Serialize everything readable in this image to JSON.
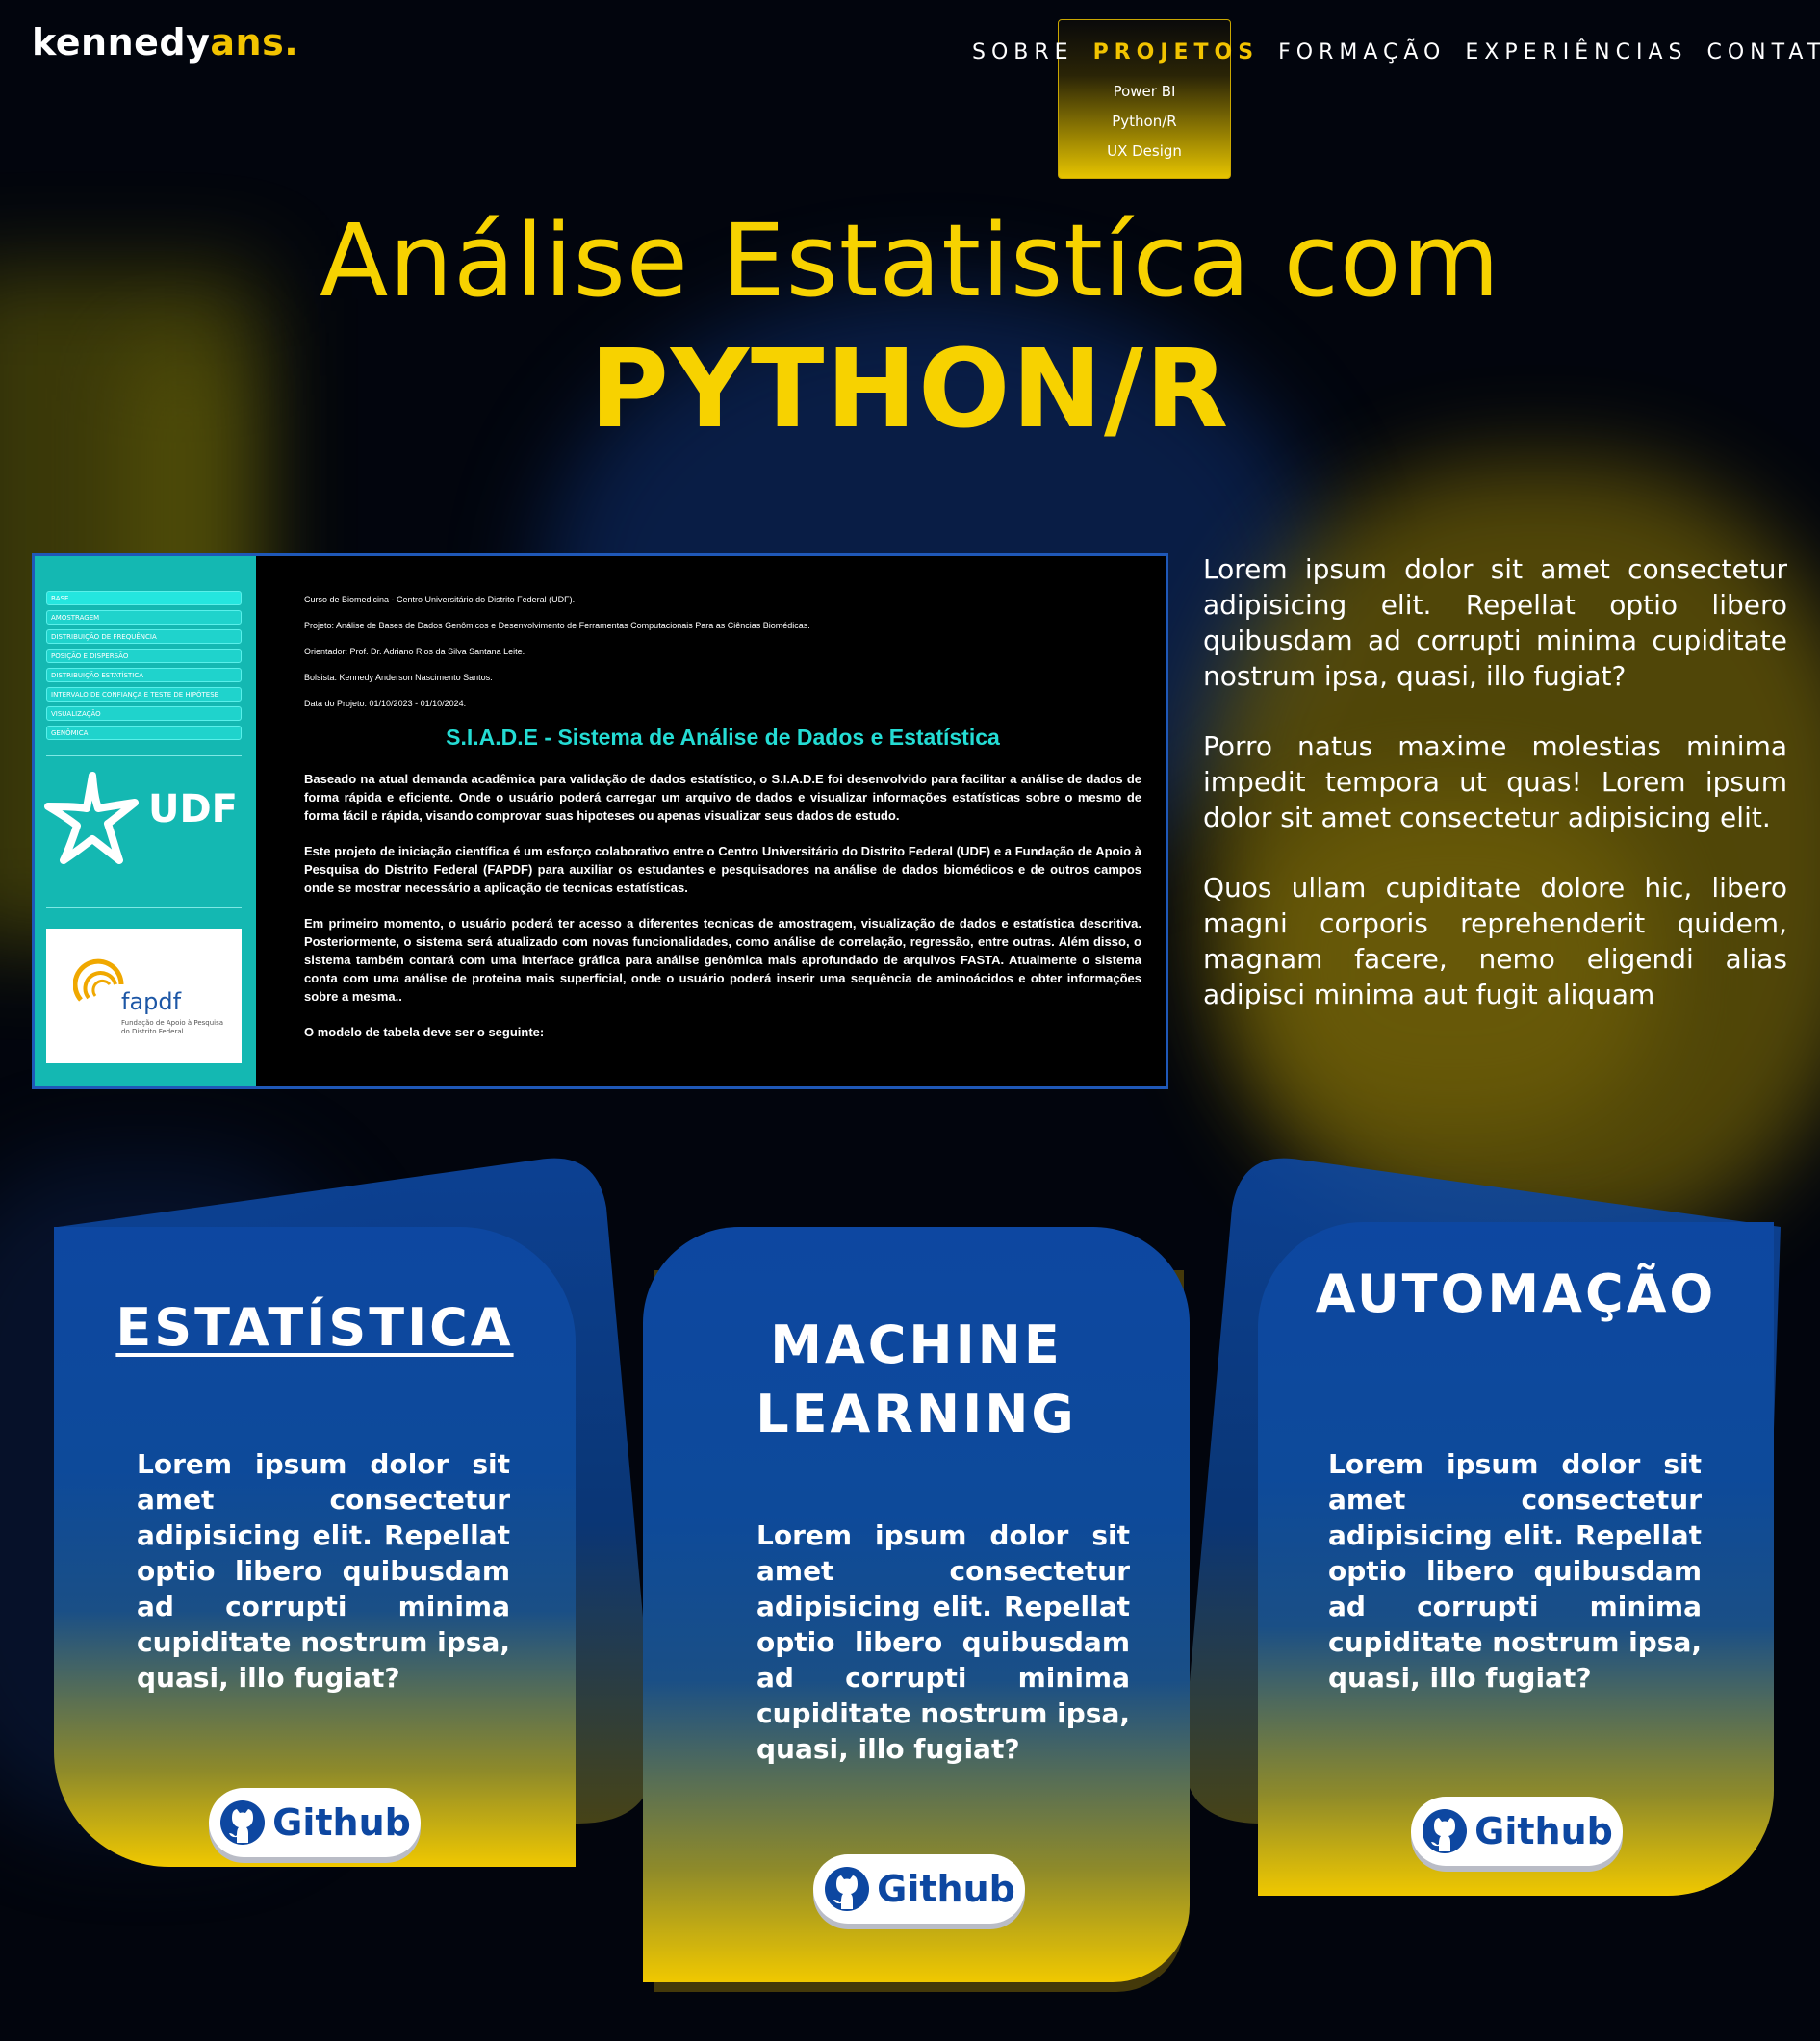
{
  "header": {
    "logo_main": "kennedy",
    "logo_accent": "ans.",
    "nav": [
      "SOBRE",
      "PROJETOS",
      "FORMAÇÃO",
      "EXPERIÊNCIAS",
      "CONTATOS"
    ],
    "dropdown": [
      "Power BI",
      "Python/R",
      "UX Design"
    ]
  },
  "hero": {
    "line1": "Análise Estatistíca com",
    "line2": "PYTHON/R"
  },
  "screenshot": {
    "menu": [
      "BASE",
      "AMOSTRAGEM",
      "DISTRIBUIÇÃO DE FREQUÊNCIA",
      "POSIÇÃO E DISPERSÃO",
      "DISTRIBUIÇÃO ESTATÍSTICA",
      "INTERVALO DE CONFIANÇA E TESTE DE HIPÓTESE",
      "VISUALIZAÇÃO",
      "GENÔMICA"
    ],
    "udf_logo": "UDF",
    "fapdf_logo": "fapdf",
    "fapdf_sub": "Fundação de Apoio à Pesquisa do Distrito Federal",
    "meta": [
      "Curso de Biomedicina - Centro Universitário do Distrito Federal (UDF).",
      "Projeto: Análise de Bases de Dados Genômicos e Desenvolvimento de Ferramentas Computacionais Para as Ciências Biomédicas.",
      "Orientador: Prof. Dr. Adriano Rios da Silva Santana Leite.",
      "Bolsista: Kennedy Anderson Nascimento Santos.",
      "Data do Projeto: 01/10/2023 - 01/10/2024."
    ],
    "title": "S.I.A.D.E - Sistema de Análise de Dados e Estatística",
    "paragraphs": [
      "Baseado na atual demanda acadêmica para validação de dados estatístico, o S.I.A.D.E foi desenvolvido para facilitar a análise de dados de forma rápida e eficiente. Onde o usuário poderá carregar um arquivo de dados e visualizar informações estatísticas sobre o mesmo de forma fácil e rápida, visando comprovar suas hipoteses ou apenas visualizar seus dados de estudo.",
      "Este projeto de iniciação científica é um esforço colaborativo entre o Centro Universitário do Distrito Federal (UDF) e a Fundação de Apoio à Pesquisa do Distrito Federal (FAPDF) para auxiliar os estudantes e pesquisadores na análise de dados biomédicos e de outros campos onde se mostrar necessário a aplicação de tecnicas estatísticas.",
      "Em primeiro momento, o usuário poderá ter acesso a diferentes tecnicas de amostragem, visualização de dados e estatística descritiva. Posteriormente, o sistema será atualizado com novas funcionalidades, como análise de correlação, regressão, entre outras. Além disso, o sistema também contará com uma interface gráfica para análise genômica mais aprofundado de arquivos FASTA. Atualmente o sistema conta com uma análise de proteina mais superficial, onde o usuário poderá inserir uma sequência de aminoácidos e obter informações sobre a mesma..",
      "O modelo de tabela deve ser o seguinte:"
    ]
  },
  "intro": [
    "Lorem ipsum dolor sit amet consectetur adipisicing elit. Repellat optio libero quibusdam ad corrupti minima cupiditate nostrum ipsa, quasi, illo fugiat?",
    "Porro natus maxime molestias minima impedit tempora ut quas! Lorem ipsum dolor sit amet consectetur adipisicing elit.",
    "Quos ullam cupiditate dolore hic, libero magni corporis reprehenderit quidem, magnam facere, nemo eligendi alias adipisci minima aut fugit aliquam"
  ],
  "cards": [
    {
      "title": "ESTATÍSTICA",
      "text": "Lorem ipsum dolor sit amet consectetur adipisicing elit. Repellat optio libero quibusdam ad corrupti minima cupiditate nostrum ipsa, quasi, illo fugiat?",
      "button": "Github"
    },
    {
      "title_line1": "MACHINE",
      "title_line2": "LEARNING",
      "text": "Lorem ipsum dolor sit amet consectetur adipisicing elit. Repellat optio libero quibusdam ad corrupti minima cupiditate nostrum ipsa, quasi, illo fugiat?",
      "button": "Github"
    },
    {
      "title": "AUTOMAÇÃO",
      "text": "Lorem ipsum dolor sit amet consectetur adipisicing elit. Repellat optio libero quibusdam ad corrupti minima cupiditate nostrum ipsa, quasi, illo fugiat?",
      "button": "Github"
    }
  ],
  "colors": {
    "accent": "#f7d200",
    "card_blue": "#0d47a1",
    "teal": "#14b8b2"
  },
  "icons": [
    "github-icon",
    "udf-star-icon",
    "fapdf-icon"
  ]
}
